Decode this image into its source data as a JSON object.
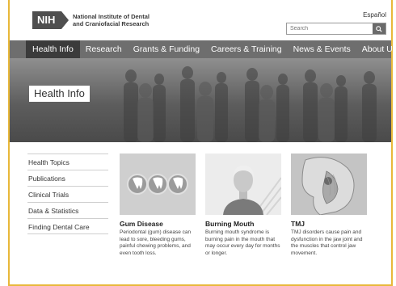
{
  "header": {
    "logo_badge": "NIH",
    "org_name": "National Institute of Dental and Craniofacial Research",
    "language_link": "Español",
    "search_placeholder": "Search",
    "search_button_icon": "search-icon"
  },
  "nav": {
    "items": [
      "Health Info",
      "Research",
      "Grants & Funding",
      "Careers & Training",
      "News & Events",
      "About Us"
    ],
    "active_index": 0
  },
  "hero": {
    "title": "Health Info"
  },
  "sidebar": {
    "items": [
      "Health Topics",
      "Publications",
      "Clinical Trials",
      "Data & Statistics",
      "Finding Dental Care"
    ]
  },
  "cards": [
    {
      "title": "Gum Disease",
      "description": "Periodontal (gum) disease can lead to sore, bleeding gums, painful chewing problems, and even tooth loss."
    },
    {
      "title": "Burning Mouth",
      "description": "Burning mouth syndrome is burning pain in the mouth that may occur every day for months or longer."
    },
    {
      "title": "TMJ",
      "description": "TMJ disorders cause pain and dysfunction in the jaw joint and the muscles that control jaw movement."
    }
  ],
  "colors": {
    "frame_border": "#e8b83a",
    "nav_background": "#6e6e6e",
    "nav_active": "#3b3b3b"
  }
}
